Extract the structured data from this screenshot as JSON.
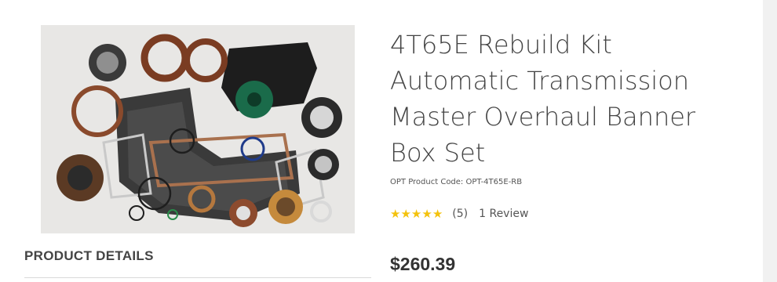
{
  "product": {
    "title": "4T65E Rebuild Kit Automatic Transmission Master Overhaul Banner Box Set",
    "code_label": "OPT Product Code: ",
    "code": "OPT-4T65E-RB",
    "rating": {
      "stars": 5,
      "max_stars": 5,
      "count": "(5)",
      "reviews_link": "1 Review"
    },
    "price": "$260.39",
    "image_icon": "transmission-kit-photo"
  },
  "details": {
    "heading": "PRODUCT DETAILS"
  },
  "colors": {
    "star": "#f4c20d",
    "title": "#444444",
    "gasket": "#a9714e",
    "band": "#7a3c22",
    "seal_dark": "#2b2b2b"
  }
}
